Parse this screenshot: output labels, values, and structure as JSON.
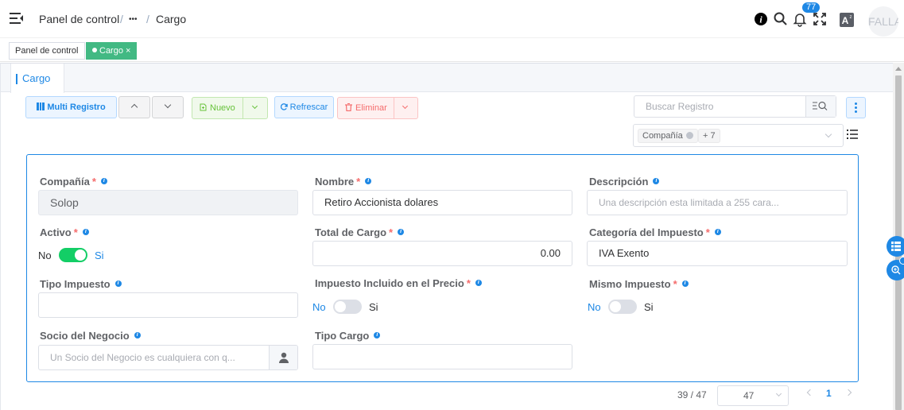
{
  "header": {
    "breadcrumb": [
      "Panel de control",
      "•••",
      "Cargo"
    ],
    "breadcrumb_sep": "/",
    "notification_count": "77",
    "avatar_text": "FALLA"
  },
  "tags": {
    "items": [
      "Panel de control",
      "Cargo"
    ],
    "close": "×"
  },
  "tab": {
    "label": "Cargo"
  },
  "toolbar": {
    "multi_registro": "Multi Registro",
    "nuevo": "Nuevo",
    "refrescar": "Refrescar",
    "eliminar": "Eliminar",
    "search_placeholder": "Buscar Registro",
    "filter_tags": [
      "Compañía",
      "+ 7"
    ]
  },
  "form": {
    "compania": {
      "label": "Compañía",
      "value": "Solop"
    },
    "nombre": {
      "label": "Nombre",
      "value": "Retiro Accionista dolares"
    },
    "descripcion": {
      "label": "Descripción",
      "placeholder": "Una descripción esta limitada a 255 cara..."
    },
    "activo": {
      "label": "Activo",
      "off": "No",
      "on": "Si",
      "checked": true
    },
    "total_cargo": {
      "label": "Total de Cargo",
      "value": "0.00"
    },
    "categoria_impuesto": {
      "label": "Categoría del Impuesto",
      "value": "IVA Exento"
    },
    "tipo_impuesto": {
      "label": "Tipo Impuesto",
      "value": ""
    },
    "impuesto_incluido": {
      "label": "Impuesto Incluido en el Precio",
      "off": "No",
      "on": "Si",
      "checked": false
    },
    "mismo_impuesto": {
      "label": "Mismo Impuesto",
      "off": "No",
      "on": "Si",
      "checked": false
    },
    "socio_negocio": {
      "label": "Socio del Negocio",
      "placeholder": "Un Socio del Negocio es cualquiera con q..."
    },
    "tipo_cargo": {
      "label": "Tipo Cargo",
      "value": ""
    },
    "required_mark": "*"
  },
  "pager": {
    "total": "39 / 47",
    "page_size": "47",
    "current_page": "1"
  },
  "colors": {
    "primary": "#1e88e5",
    "success": "#13ce66",
    "danger": "#f56c6c",
    "tag_active": "#42b983"
  }
}
